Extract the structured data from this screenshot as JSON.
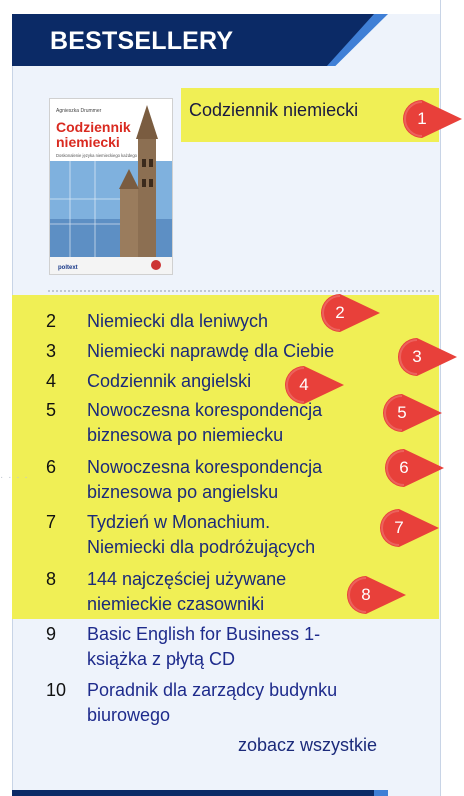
{
  "header": {
    "title": "BESTSELLERY"
  },
  "featured": {
    "title": "Codziennik niemiecki",
    "cover": {
      "author": "Agnieszka Drummer",
      "title_line1": "Codziennik",
      "title_line2": "niemiecki",
      "subtitle": "Doskonalenie języka niemieckiego każdego dnia",
      "publisher": "poltext"
    }
  },
  "list": [
    {
      "num": "2",
      "lines": [
        "Niemiecki dla leniwych"
      ]
    },
    {
      "num": "3",
      "lines": [
        "Niemiecki naprawdę dla Ciebie"
      ]
    },
    {
      "num": "4",
      "lines": [
        "Codziennik angielski"
      ]
    },
    {
      "num": "5",
      "lines": [
        "Nowoczesna korespondencja",
        "biznesowa po niemiecku"
      ]
    },
    {
      "num": "6",
      "lines": [
        "Nowoczesna korespondencja",
        "biznesowa po angielsku"
      ]
    },
    {
      "num": "7",
      "lines": [
        "Tydzień w Monachium.",
        "Niemiecki dla podróżujących"
      ]
    },
    {
      "num": "8",
      "lines": [
        "144 najczęściej używane",
        "niemieckie czasowniki"
      ]
    },
    {
      "num": "9",
      "lines": [
        "Basic English for Business 1-",
        "książka z płytą CD"
      ]
    },
    {
      "num": "10",
      "lines": [
        "Poradnik dla zarządcy budynku",
        "biurowego"
      ]
    }
  ],
  "see_all": "zobacz wszystkie",
  "markers": [
    "1",
    "2",
    "3",
    "4",
    "5",
    "6",
    "7",
    "8"
  ],
  "colors": {
    "highlight": "#f0ef55",
    "marker": "#e8403a",
    "header_dark": "#0b2a66",
    "header_light": "#3f7fd6"
  }
}
